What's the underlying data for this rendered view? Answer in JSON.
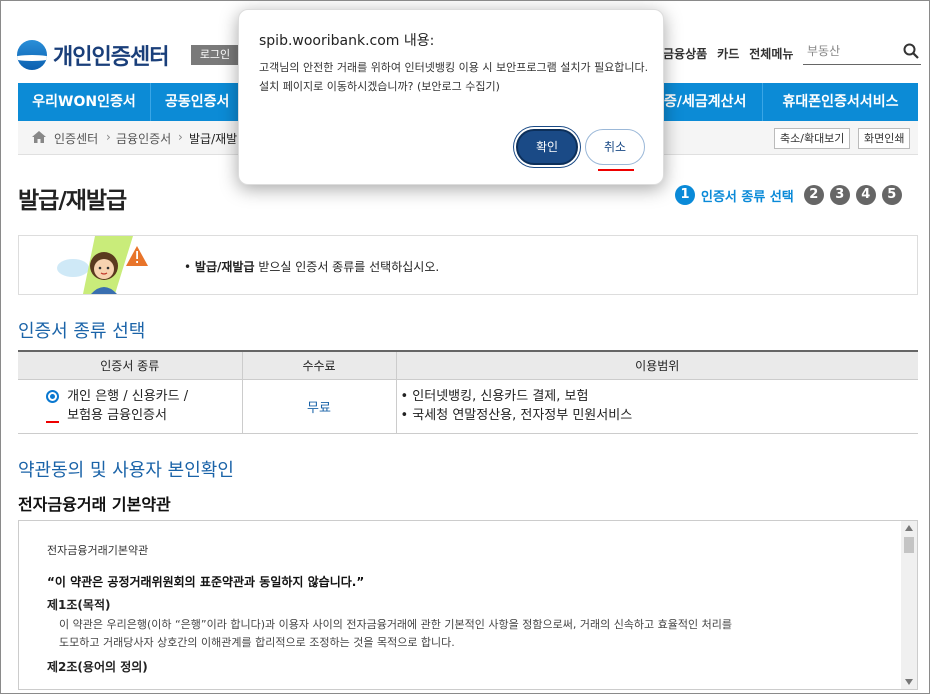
{
  "header": {
    "logo_text": "개인인증센터",
    "login_label": "로그인",
    "top_links": [
      "금융상품",
      "카드",
      "전체메뉴"
    ],
    "search_value": "부동산"
  },
  "gnb": {
    "items": [
      "우리WON인증서",
      "공동인증서",
      "증/세금계산서",
      "휴대폰인증서서비스"
    ]
  },
  "breadcrumb": {
    "items": [
      "인증센터",
      "금융인증서",
      "발급/재발"
    ],
    "zoom_label": "축소/확대보기",
    "print_label": "화면인쇄"
  },
  "page": {
    "title": "발급/재발급",
    "steps": {
      "current_num": "1",
      "current_label": "인증서 종류 선택",
      "others": [
        "2",
        "3",
        "4",
        "5"
      ]
    },
    "guide_prefix": "• ",
    "guide_bold": "발급/재발급",
    "guide_rest": " 받으실 인증서 종류를 선택하십시오."
  },
  "cert_section": {
    "title": "인증서 종류 선택",
    "headers": [
      "인증서 종류",
      "수수료",
      "이용범위"
    ],
    "row": {
      "type_line1": "개인 은행 / 신용카드 /",
      "type_line2": "보험용 금융인증서",
      "fee": "무료",
      "scope1": "• 인터넷뱅킹, 신용카드 결제, 보험",
      "scope2": "• 국세청 연말정산용, 전자정부 민원서비스"
    }
  },
  "terms_section": {
    "title": "약관동의 및 사용자 본인확인",
    "subtitle": "전자금융거래 기본약관",
    "box_heading": "전자금융거래기본약관",
    "notice": "“이 약관은 공정거래위원회의 표준약관과 동일하지 않습니다.”",
    "art1_title": "제1조(목적)",
    "art1_line1": "이 약관은 우리은행(이하 “은행”이라 합니다)과 이용자 사이의 전자금융거래에 관한 기본적인 사항을 정함으로써, 거래의 신속하고 효율적인 처리를",
    "art1_line2": "도모하고 거래당사자 상호간의 이해관계를 합리적으로 조정하는 것을 목적으로 합니다.",
    "art2_title": "제2조(용어의 정의)"
  },
  "dialog": {
    "title": "spib.wooribank.com 내용:",
    "message": "고객님의 안전한 거래를 위하여 인터넷뱅킹 이용 시 보안프로그램 설치가 필요합니다. 설치 페이지로 이동하시겠습니까? (보안로그 수집기)",
    "ok_label": "확인",
    "cancel_label": "취소"
  },
  "colors": {
    "accent": "#0c8bd6",
    "title_blue": "#1a63a8",
    "ok_button": "#1a4a86",
    "highlight_red": "#e00000"
  }
}
